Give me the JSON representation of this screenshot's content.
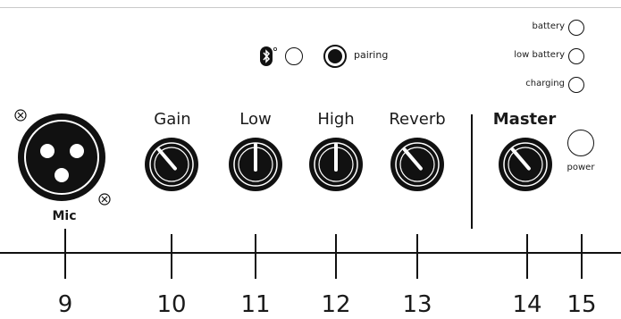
{
  "indicators": {
    "pairing_label": "pairing",
    "battery_label": "battery",
    "low_battery_label": "low battery",
    "charging_label": "charging",
    "power_label": "power"
  },
  "input": {
    "label": "Mic"
  },
  "knobs": [
    {
      "label": "Gain",
      "level": 0.35
    },
    {
      "label": "Low",
      "level": 0.5
    },
    {
      "label": "High",
      "level": 0.5
    },
    {
      "label": "Reverb",
      "level": 0.35
    },
    {
      "label": "Master",
      "level": 0.35
    }
  ],
  "callouts": [
    "9",
    "10",
    "11",
    "12",
    "13",
    "14",
    "15"
  ]
}
